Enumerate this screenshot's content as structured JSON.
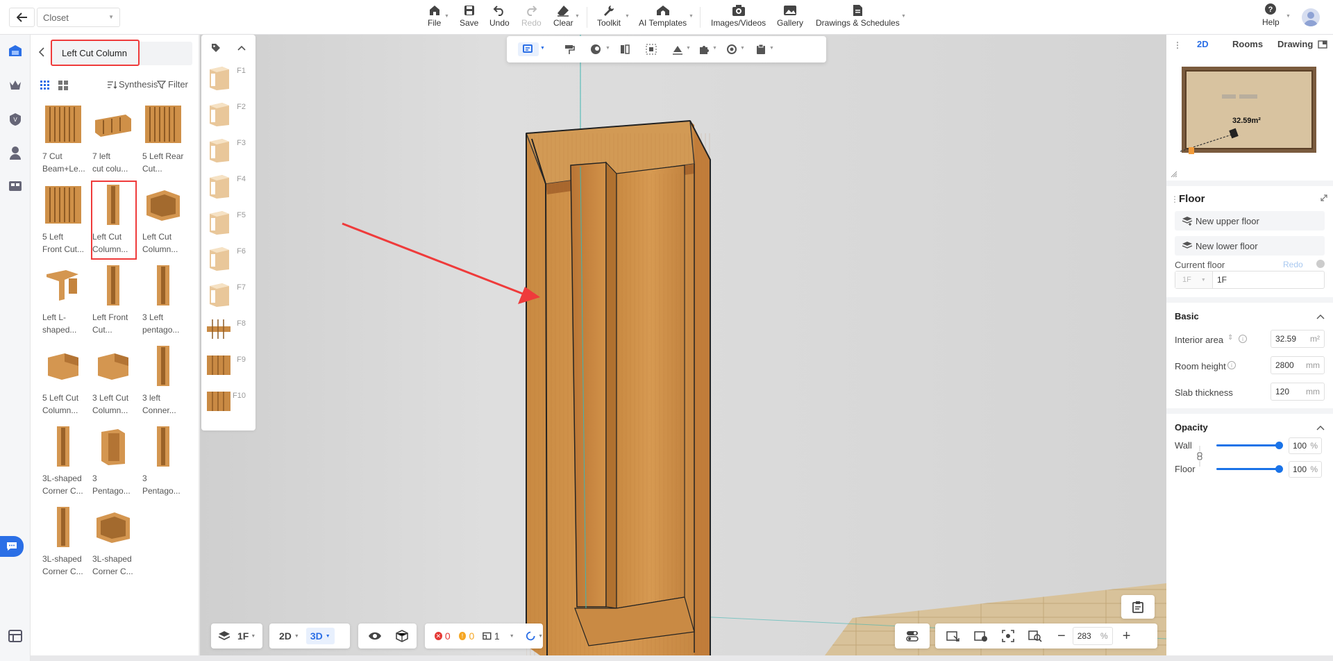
{
  "topbar": {
    "design_name": "Closet",
    "buttons": [
      {
        "id": "file",
        "label": "File"
      },
      {
        "id": "save",
        "label": "Save"
      },
      {
        "id": "undo",
        "label": "Undo"
      },
      {
        "id": "redo",
        "label": "Redo"
      },
      {
        "id": "clear",
        "label": "Clear"
      },
      {
        "id": "toolkit",
        "label": "Toolkit"
      },
      {
        "id": "ai",
        "label": "AI Templates"
      },
      {
        "id": "images",
        "label": "Images/Videos"
      },
      {
        "id": "gallery",
        "label": "Gallery"
      },
      {
        "id": "drawings",
        "label": "Drawings & Schedules"
      }
    ],
    "help_label": "Help"
  },
  "catalog": {
    "search_value": "Left Cut Column",
    "synthesis_label": "Synthesis",
    "filter_label": "Filter",
    "items": [
      {
        "label1": "7 Cut",
        "label2": "Beam+Le..."
      },
      {
        "label1": "7 left",
        "label2": "cut colu..."
      },
      {
        "label1": "5 Left Rear",
        "label2": "Cut..."
      },
      {
        "label1": "5 Left",
        "label2": "Front Cut..."
      },
      {
        "label1": "Left Cut",
        "label2": "Column..."
      },
      {
        "label1": "Left Cut",
        "label2": "Column..."
      },
      {
        "label1": "Left L-",
        "label2": "shaped..."
      },
      {
        "label1": "Left Front",
        "label2": "Cut..."
      },
      {
        "label1": "3 Left",
        "label2": "pentago..."
      },
      {
        "label1": "5 Left Cut",
        "label2": "Column..."
      },
      {
        "label1": "3 Left Cut",
        "label2": "Column..."
      },
      {
        "label1": "3 left",
        "label2": "Conner..."
      },
      {
        "label1": "3L-shaped",
        "label2": "Corner C..."
      },
      {
        "label1": "3",
        "label2": "Pentago..."
      },
      {
        "label1": "3",
        "label2": "Pentago..."
      },
      {
        "label1": "3L-shaped",
        "label2": "Corner C..."
      },
      {
        "label1": "3L-shaped",
        "label2": "Corner C..."
      }
    ]
  },
  "strip": {
    "keys": [
      "F1",
      "F2",
      "F3",
      "F4",
      "F5",
      "F6",
      "F7",
      "F8",
      "F9",
      "F10"
    ]
  },
  "bottom": {
    "floor": "1F",
    "mode_2d": "2D",
    "mode_3d": "3D",
    "errors": "0",
    "warnings": "0",
    "rooms": "1",
    "zoom": "283",
    "zoom_unit": "%"
  },
  "right": {
    "tabs": [
      "2D",
      "Rooms",
      "Drawing"
    ],
    "area_label": "32.59m²",
    "panel_title": "Floor",
    "new_upper": "New upper floor",
    "new_lower": "New lower floor",
    "current_floor_label": "Current floor",
    "redo_label": "Redo",
    "floor_short": "1F",
    "floor_value": "1F",
    "basic_label": "Basic",
    "interior_area_label": "Interior area",
    "interior_area_value": "32.59",
    "interior_area_unit": "m²",
    "room_height_label": "Room height",
    "room_height_value": "2800",
    "room_height_unit": "mm",
    "slab_label": "Slab thickness",
    "slab_value": "120",
    "slab_unit": "mm",
    "opacity_label": "Opacity",
    "wall_label": "Wall",
    "wall_value": "100",
    "floor_label": "Floor",
    "floor_opacity_value": "100",
    "pct": "%",
    "wall_level": 1.0,
    "floor_level": 1.0
  },
  "colors": {
    "accent": "#1a73e8",
    "highlight": "#ef3b3b",
    "wood": "#d99a4e"
  }
}
